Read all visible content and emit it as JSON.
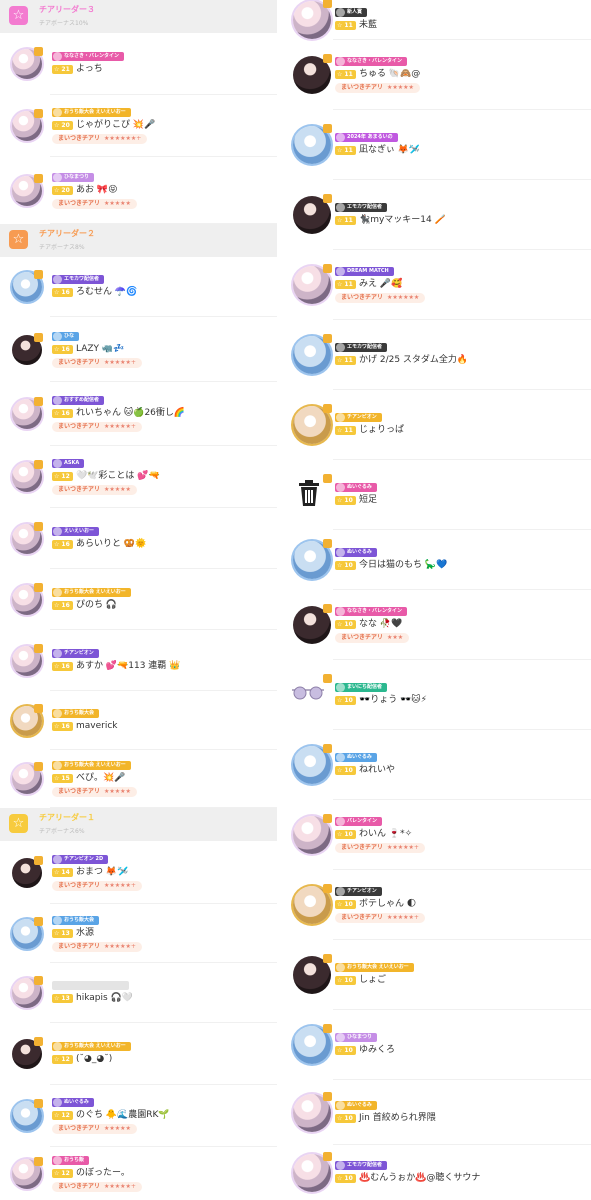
{
  "sections": {
    "s3": {
      "title": "チアリーダー３",
      "subtitle": "チアボーナス10%",
      "color": "#f37bd0"
    },
    "s2": {
      "title": "チアリーダー２",
      "subtitle": "チアボーナス8%",
      "color": "#f79b52"
    },
    "s1": {
      "title": "チアリーダー１",
      "subtitle": "チアボーナス6%",
      "color": "#f7cb3e"
    }
  },
  "tag_label": "まいつきチアリ",
  "left": [
    {
      "id": "l1",
      "name": "よっち",
      "level": "21",
      "banner": "ななさき・バレンタイン",
      "banner_color": "#e85aa8",
      "tag": "",
      "av": "pink"
    },
    {
      "id": "l2",
      "name": "じゃがりこぴ 💥🎤",
      "level": "20",
      "banner": "おうち飯大会 えいえいおー",
      "banner_color": "#f2b52a",
      "tag": "★★★★★★+",
      "av": "pink"
    },
    {
      "id": "l3",
      "name": "あお 🎀😝",
      "level": "20",
      "banner": "ひなまつり",
      "banner_color": "#c58ee6",
      "tag": "★★★★★",
      "av": "pink"
    },
    {
      "id": "l4",
      "name": "ろむせん ☂️🌀",
      "level": "16",
      "banner": "エモカワ配信者",
      "banner_color": "#7d55d6",
      "tag": "",
      "av": "blue"
    },
    {
      "id": "l5",
      "name": "LAZY 🦏💤",
      "level": "16",
      "banner": "ひな",
      "banner_color": "#5aa4e6",
      "tag": "★★★★★+",
      "av": "dark"
    },
    {
      "id": "l6",
      "name": "れいちゃん 🐱🍏26衝し🌈",
      "level": "16",
      "banner": "おすすめ配信者",
      "banner_color": "#7d55d6",
      "tag": "★★★★★+",
      "av": "pink"
    },
    {
      "id": "l7",
      "name": "🤍🕊️彩ことは 💕🔫",
      "level": "12",
      "banner": "ASKA",
      "banner_color": "#7d55d6",
      "tag": "★★★★★",
      "av": "pink"
    },
    {
      "id": "l8",
      "name": "あらいりと 🥨🌞",
      "level": "16",
      "banner": "えいえいおー",
      "banner_color": "#7d55d6",
      "tag": "",
      "av": "pink"
    },
    {
      "id": "l9",
      "name": "ぴのち 🎧",
      "level": "16",
      "banner": "おうち飯大会 えいえいおー",
      "banner_color": "#f2b52a",
      "tag": "",
      "av": "pink"
    },
    {
      "id": "l10",
      "name": "あすか 💕🔫113 連覇 👑",
      "level": "16",
      "banner": "チアンピオン",
      "banner_color": "#7d55d6",
      "tag": "",
      "av": "pink"
    },
    {
      "id": "l11",
      "name": "maverick",
      "level": "16",
      "banner": "おうち飯大会",
      "banner_color": "#f2b52a",
      "tag": "",
      "av": "gold"
    },
    {
      "id": "l12",
      "name": "べぴ。💥🎤",
      "level": "15",
      "banner": "おうち飯大会 えいえいおー",
      "banner_color": "#f2b52a",
      "tag": "★★★★★",
      "av": "pink"
    },
    {
      "id": "l13",
      "name": "おまつ 🦊🛩️",
      "level": "14",
      "banner": "チアンピオン 2D",
      "banner_color": "#7d55d6",
      "tag": "★★★★★+",
      "av": "dark"
    },
    {
      "id": "l14",
      "name": "水源",
      "level": "13",
      "banner": "おうち飯大会",
      "banner_color": "#5aa4e6",
      "tag": "★★★★★+",
      "av": "blue"
    },
    {
      "id": "l15",
      "name": "hikapis 🎧🤍",
      "level": "13",
      "banner": "",
      "banner_color": "#dddddd",
      "tag": "",
      "av": "pink"
    },
    {
      "id": "l16",
      "name": "(˘◕_◕˘)",
      "level": "12",
      "banner": "おうち飯大会 えいえいおー",
      "banner_color": "#f2b52a",
      "tag": "",
      "av": "dark"
    },
    {
      "id": "l17",
      "name": "のぐち 🐥🌊農園RK🌱",
      "level": "12",
      "banner": "ぬいぐるみ",
      "banner_color": "#7d55d6",
      "tag": "★★★★★",
      "av": "blue"
    },
    {
      "id": "l18",
      "name": "のぼったー。",
      "level": "12",
      "banner": "おうち飯",
      "banner_color": "#e85aa8",
      "tag": "★★★★★+",
      "av": "pink"
    }
  ],
  "right": [
    {
      "id": "r1",
      "name": "未藍",
      "level": "11",
      "banner": "新人賞",
      "banner_color": "#3a3a3a",
      "tag": "",
      "av": "pink"
    },
    {
      "id": "r2",
      "name": "ちゅる 🐚🙈@",
      "level": "11",
      "banner": "ななさき・バレンタイン",
      "banner_color": "#e85aa8",
      "tag": "★★★★★",
      "av": "dark"
    },
    {
      "id": "r3",
      "name": "凪なぎぃ 🦊🛩️",
      "level": "11",
      "banner": "2024年 あまるいの",
      "banner_color": "#c058e0",
      "tag": "",
      "av": "blue"
    },
    {
      "id": "r4",
      "name": "🐈‍⬛myマッキー14 🪥",
      "level": "11",
      "banner": "エモカワ配信者",
      "banner_color": "#3a3a3a",
      "tag": "",
      "av": "dark"
    },
    {
      "id": "r5",
      "name": "みえ 🎤🥰",
      "level": "11",
      "banner": "DREAM MATCH",
      "banner_color": "#7d55d6",
      "tag": "★★★★★★",
      "av": "pink"
    },
    {
      "id": "r6",
      "name": "かげ 2/25 スタダム全力🔥",
      "level": "11",
      "banner": "エモカワ配信者",
      "banner_color": "#3a3a3a",
      "tag": "",
      "av": "blue"
    },
    {
      "id": "r7",
      "name": "じょりっぱ",
      "level": "11",
      "banner": "チアンピオン",
      "banner_color": "#f2b52a",
      "tag": "",
      "av": "gold"
    },
    {
      "id": "r8",
      "name": "短足",
      "level": "10",
      "banner": "ぬいぐるみ",
      "banner_color": "#e85aa8",
      "tag": "",
      "av": "none"
    },
    {
      "id": "r9",
      "name": "今日は猫のもち 🦕💙",
      "level": "10",
      "banner": "ぬいぐるみ",
      "banner_color": "#7d55d6",
      "tag": "",
      "av": "blue"
    },
    {
      "id": "r10",
      "name": "なな 🥀🖤",
      "level": "10",
      "banner": "ななさき・バレンタイン",
      "banner_color": "#e85aa8",
      "tag": "★★★",
      "av": "dark"
    },
    {
      "id": "r11",
      "name": "🕶️りょう 🕶️🐱⚡",
      "level": "10",
      "banner": "まいにち配信者",
      "banner_color": "#2bb88f",
      "tag": "",
      "av": "none"
    },
    {
      "id": "r12",
      "name": "ねれいや",
      "level": "10",
      "banner": "ぬいぐるみ",
      "banner_color": "#5aa4e6",
      "tag": "",
      "av": "blue"
    },
    {
      "id": "r13",
      "name": "わいん 🍷*✧",
      "level": "10",
      "banner": "バレンタイン",
      "banner_color": "#e85aa8",
      "tag": "★★★★★+",
      "av": "pink"
    },
    {
      "id": "r14",
      "name": "ボテしゃん 🌓",
      "level": "10",
      "banner": "チアンピオン",
      "banner_color": "#3a3a3a",
      "tag": "★★★★★+",
      "av": "gold"
    },
    {
      "id": "r15",
      "name": "しょご",
      "level": "10",
      "banner": "おうち飯大会 えいえいおー",
      "banner_color": "#f2b52a",
      "tag": "",
      "av": "dark"
    },
    {
      "id": "r16",
      "name": "ゆみくろ",
      "level": "10",
      "banner": "ひなまつり",
      "banner_color": "#c58ee6",
      "tag": "",
      "av": "blue"
    },
    {
      "id": "r17",
      "name": "Jin 首絞められ界隈",
      "level": "10",
      "banner": "ぬいぐるみ",
      "banner_color": "#f2b52a",
      "tag": "",
      "av": "pink"
    },
    {
      "id": "r18",
      "name": "♨️むんうぉか♨️@聴くサウナ",
      "level": "10",
      "banner": "エモカワ配信者",
      "banner_color": "#7d55d6",
      "tag": "",
      "av": "pink"
    }
  ]
}
